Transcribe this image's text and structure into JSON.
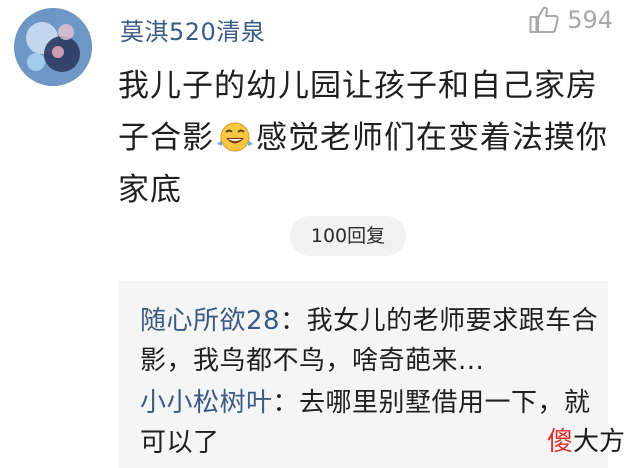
{
  "comment": {
    "username": "莫淇520清泉",
    "like_count": "594",
    "text_before_emoji": "我儿子的幼儿园让孩子和自己家房子合影",
    "emoji": "crying-laughing-emoji",
    "text_after_emoji": "感觉老师们在变着法摸你家底",
    "replies_button": "100回复"
  },
  "replies": [
    {
      "name": "随心所欲28",
      "separator": "：",
      "text": "我女儿的老师要求跟车合影，我鸟都不鸟，啥奇葩来..."
    },
    {
      "name": "小小松树叶",
      "separator": "：",
      "text": "去哪里别墅借用一下，就可以了"
    }
  ],
  "watermark": {
    "accent_char": "傻",
    "rest": "大方"
  },
  "colors": {
    "username": "#3a5b85",
    "meta": "#a8a8a8",
    "watermark_accent": "#d8312a"
  }
}
